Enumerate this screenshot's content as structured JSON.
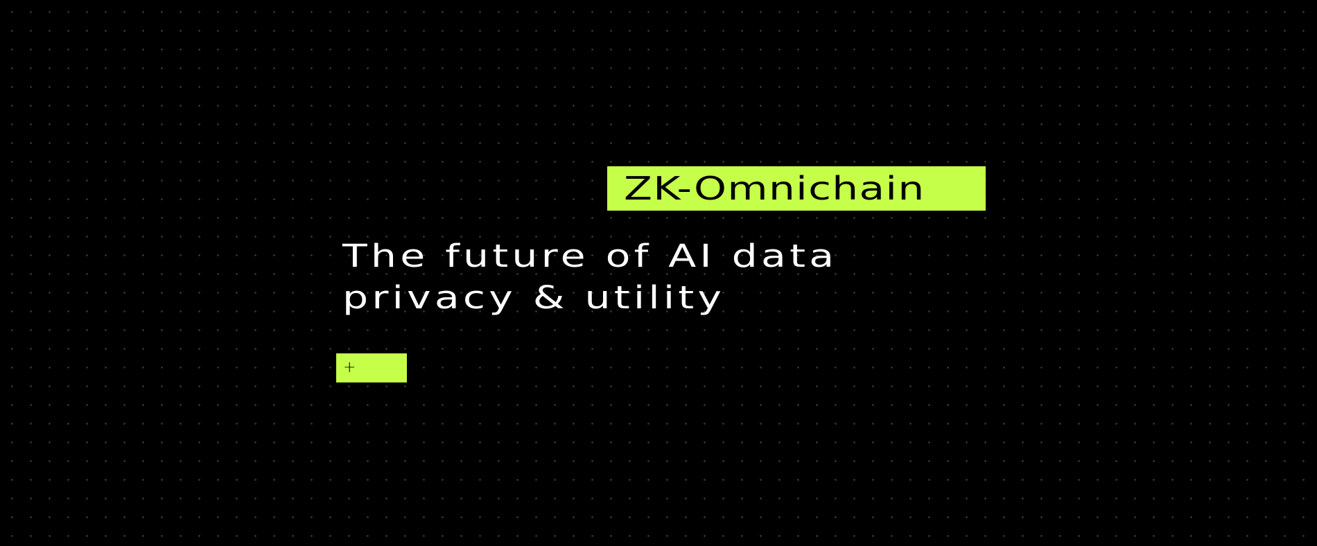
{
  "badge": {
    "label": "ZK-Omnichain"
  },
  "hero": {
    "headline_line1": "The future of AI data",
    "headline_line2": "privacy & utility"
  },
  "cta": {
    "icon_glyph": "+",
    "icon_name": "plus-icon"
  },
  "colors": {
    "background": "#000000",
    "accent": "#c6ff4a",
    "text": "#ffffff",
    "dot_grid": "#3a3a3a"
  }
}
